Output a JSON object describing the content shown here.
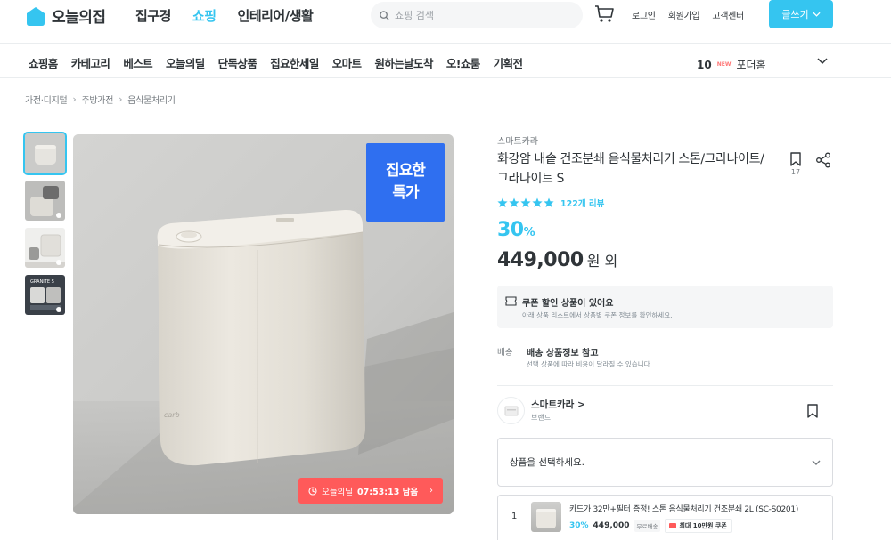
{
  "header": {
    "logo_text": "오늘의집",
    "nav": [
      "집구경",
      "쇼핑",
      "인테리어/생활"
    ],
    "active_nav": "쇼핑",
    "search_placeholder": "쇼핑 검색",
    "util": [
      "로그인",
      "회원가입",
      "고객센터"
    ],
    "write_button": "글쓰기",
    "accent_color": "#35c5f0"
  },
  "subnav": {
    "items": [
      "쇼핑홈",
      "카테고리",
      "베스트",
      "오늘의딜",
      "단독상품",
      "집요한세일",
      "오마트",
      "원하는날도착",
      "오!쇼룸",
      "기획전"
    ],
    "rank_number": "10",
    "rank_new": "NEW",
    "rank_keyword": "포더홈"
  },
  "breadcrumb": [
    "가전·디지털",
    "주방가전",
    "음식물처리기"
  ],
  "gallery": {
    "badge_line1": "집요한",
    "badge_line2": "특가",
    "timer_label": "오늘의딜",
    "timer_value": "07:53:13 남음"
  },
  "product": {
    "brand": "스마트카라",
    "title": "화강암 내솥 건조분쇄 음식물처리기 스톤/그라나이트/그라나이트 S",
    "bookmark_count": "17",
    "rating": 5,
    "review_count": "122개 리뷰",
    "discount_rate": "30",
    "discount_unit": "%",
    "price": "449,000",
    "price_suffix": "원 외"
  },
  "coupon": {
    "title": "쿠폰 할인 상품이 있어요",
    "subtitle": "아래 상품 리스트에서 상품별 쿠폰 정보를 확인하세요."
  },
  "shipping": {
    "label": "배송",
    "title": "배송 상품정보 참고",
    "subtitle": "선택 상품에 따라 비용이 달라질 수 있습니다"
  },
  "brand_row": {
    "name": "스마트카라 >",
    "type": "브랜드"
  },
  "select": {
    "placeholder": "상품을 선택하세요."
  },
  "option": {
    "index": "1",
    "title": "카드가 32만+필터 증정! 스톤 음식물처리기 건조분쇄 2L (SC-S0201)",
    "discount": "30%",
    "price": "449,000",
    "shipping_tag": "무료배송",
    "coupon": "최대 10만원 쿠폰"
  }
}
